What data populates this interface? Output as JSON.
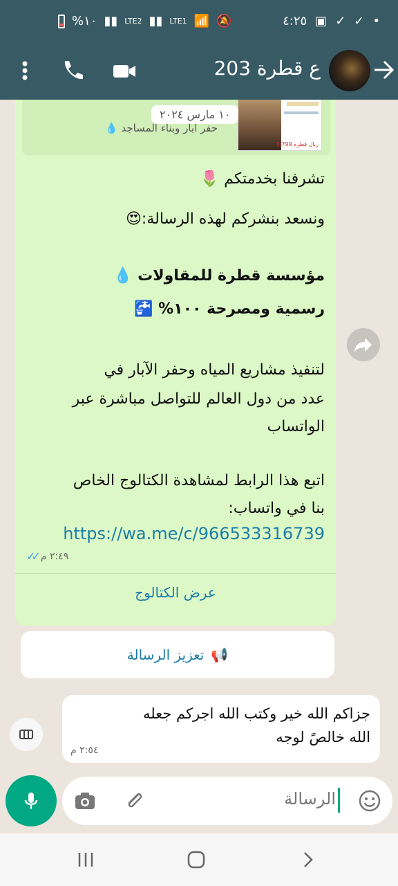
{
  "status": {
    "time": "٤:٢٥",
    "battery": "%١٠",
    "net1": "LTE2",
    "net2": "LTE1",
    "vo": "Vo))"
  },
  "header": {
    "contact": "ع قطرة 203"
  },
  "preview": {
    "date_chip": "١٠ مارس ٢٠٢٤",
    "subtitle": "حفر آبار وبناء المساجد",
    "price": "3,799 ريال قطرة"
  },
  "message": {
    "l1": "تشرفنا بخدمتكم",
    "l2": "ونسعد بنشركم لهذه الرسالة:",
    "l3": "مؤسسة قطرة للمقاولات",
    "l4": "رسمية ومصرحة ١٠٠%",
    "l5": "لتنفيذ مشاريع المياه وحفر الآبار في",
    "l6": "عدد من دول العالم للتواصل مباشرة عبر",
    "l7": "الواتساب",
    "l8": "اتبع هذا الرابط لمشاهدة الكتالوج الخاص",
    "l9": "بنا في واتساب:",
    "link": "https://wa.me/c/966533316739",
    "time": "٢:٤٩ م",
    "catalog_btn": "عرض الكتالوج"
  },
  "boost": {
    "label": "تعزيز الرسالة"
  },
  "reply": {
    "text_l1": "جزاكم الله خير وكتب الله اجركم جعله",
    "text_l2": "الله  خالصً لوجه",
    "time": "٢:٥٤ م"
  },
  "input": {
    "placeholder": "الرسالة"
  },
  "icons": {
    "mic": "mic-icon",
    "camera": "camera-icon",
    "attach": "paperclip-icon",
    "emoji": "emoji-icon"
  },
  "colors": {
    "header": "#385a64",
    "bubble_in": "#dcf8c6",
    "mic": "#00a884",
    "link": "#1c7ea8"
  }
}
